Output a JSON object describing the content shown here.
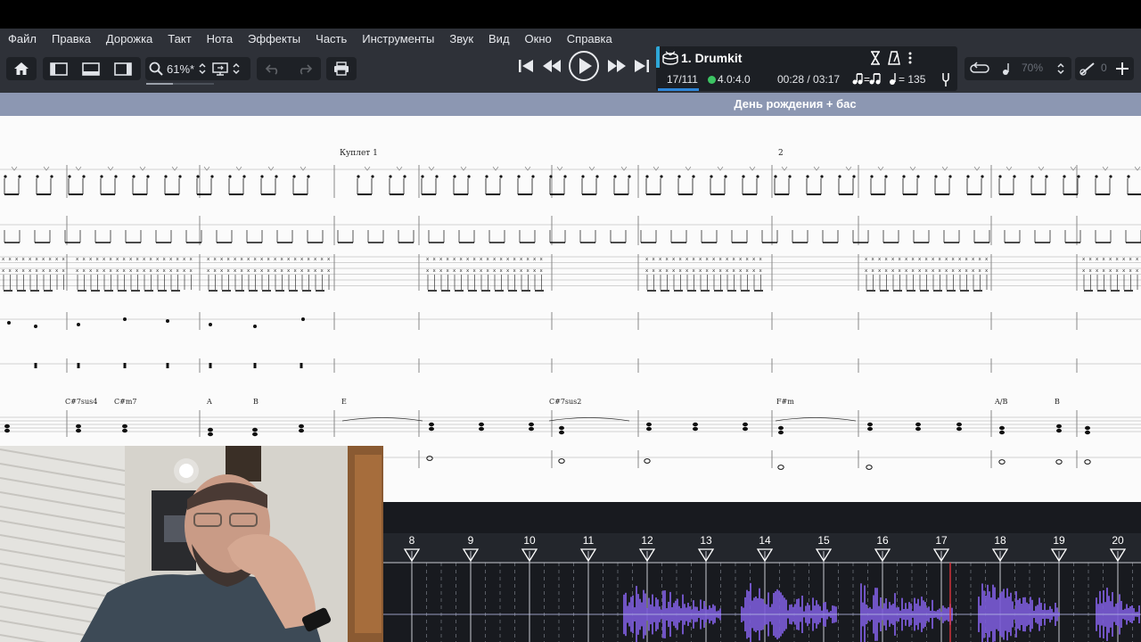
{
  "menu": [
    "Файл",
    "Правка",
    "Дорожка",
    "Такт",
    "Нота",
    "Эффекты",
    "Часть",
    "Инструменты",
    "Звук",
    "Вид",
    "Окно",
    "Справка"
  ],
  "toolbar": {
    "zoom_value": "61%*",
    "icons": [
      "home-icon",
      "layout-left-icon",
      "layout-center-icon",
      "layout-right-icon",
      "zoom-icon",
      "screen-fit-icon",
      "undo-icon",
      "redo-icon",
      "print-icon"
    ]
  },
  "transport": {
    "icons": [
      "skip-start-icon",
      "rewind-icon",
      "play-icon",
      "fast-forward-icon",
      "skip-end-icon"
    ]
  },
  "track": {
    "name": "1. Drumkit",
    "bar_position": "17/111",
    "beat_position": "4.0:4.0",
    "time": "00:28 / 03:17",
    "tempo": "= 135",
    "status_color": "#3cc463",
    "accent_color": "#2ea7d8"
  },
  "playback": {
    "speed": "70%",
    "pitch": "0"
  },
  "score": {
    "title": "День рождения + бас",
    "section_label": "Куплет 1",
    "measure_number": "2",
    "chords": [
      "C#7sus4",
      "C#m7",
      "A",
      "B",
      "E",
      "C#7sus2",
      "F#m",
      "A/B",
      "B"
    ]
  },
  "timeline": {
    "measures": [
      "8",
      "9",
      "10",
      "11",
      "12",
      "13",
      "14",
      "15",
      "16",
      "17",
      "18",
      "19",
      "20"
    ],
    "waveform_color": "#7a5bd6",
    "playhead_color": "#d2333a"
  }
}
